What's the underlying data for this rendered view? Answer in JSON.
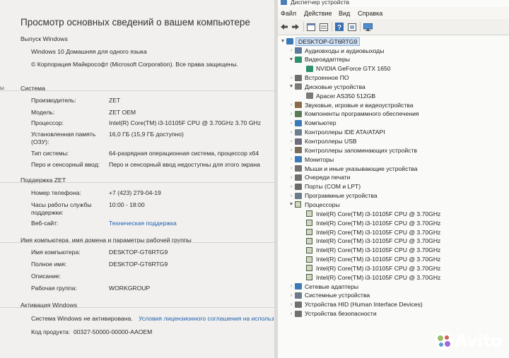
{
  "system_panel": {
    "title": "Просмотр основных сведений о вашем компьютере",
    "edition_section": "Выпуск Windows",
    "edition": "Windows 10 Домашняя для одного языка",
    "copyright": "© Корпорация Майкрософт (Microsoft Corporation). Все права защищены.",
    "edge_label_1": "",
    "edge_label_2": "ы",
    "system_section": "Система",
    "system_rows": [
      {
        "label": "Производитель:",
        "value": "ZET"
      },
      {
        "label": "Модель:",
        "value": "ZET OEM"
      },
      {
        "label": "Процессор:",
        "value": "Intel(R) Core(TM) i3-10105F CPU @ 3.70GHz   3.70 GHz"
      },
      {
        "label": "Установленная память\n(ОЗУ):",
        "value": "16,0 ГБ (15,9 ГБ доступно)"
      },
      {
        "label": "Тип системы:",
        "value": "64-разрядная операционная система, процессор x64"
      },
      {
        "label": "Перо и сенсорный ввод:",
        "value": "Перо и сенсорный ввод недоступны для этого экрана"
      }
    ],
    "support_section": "Поддержка ZET",
    "support_rows": [
      {
        "label": "Номер телефона:",
        "value": "+7 (423) 279-04-19"
      },
      {
        "label": "Часы работы службы\nподдержки:",
        "value": "10:00 - 18:00"
      },
      {
        "label": "Веб-сайт:",
        "value": "Техническая поддержка"
      }
    ],
    "name_section": "Имя компьютера, имя домена и параметры рабочей группы",
    "name_rows": [
      {
        "label": "Имя компьютера:",
        "value": "DESKTOP-GT6RTG9"
      },
      {
        "label": "Полное имя:",
        "value": "DESKTOP-GT6RTG9"
      },
      {
        "label": "Описание:",
        "value": ""
      },
      {
        "label": "Рабочая группа:",
        "value": "WORKGROUP"
      }
    ],
    "activation_section": "Активация Windows",
    "activation_status": "Система Windows не активирована.",
    "activation_link": "Условия лицензионного соглашения на использ",
    "product_code_label": "Код продукта:",
    "product_code": "00327-50000-00000-AAOEM"
  },
  "device_manager": {
    "window_title": "Диспетчер устройств",
    "menu": [
      "Файл",
      "Действие",
      "Вид",
      "Справка"
    ],
    "toolbar_icons": [
      "back-arrow-icon",
      "forward-arrow-icon",
      "properties-icon",
      "list-icon",
      "help-icon",
      "update-driver-icon",
      "monitor-scan-icon"
    ],
    "root": "DESKTOP-GT6RTG9",
    "nodes": [
      {
        "label": "Аудиовходы и аудиовыходы",
        "level": 1,
        "expanded": false,
        "icon": "audio-icon",
        "color": "#5a7a9a"
      },
      {
        "label": "Видеоадаптеры",
        "level": 1,
        "expanded": true,
        "icon": "display-adapter-icon",
        "color": "#2f8f6f"
      },
      {
        "label": "NVIDIA GeForce GTX 1650",
        "level": 2,
        "icon": "display-adapter-icon",
        "color": "#2f8f6f"
      },
      {
        "label": "Встроенное ПО",
        "level": 1,
        "expanded": false,
        "icon": "firmware-icon",
        "color": "#6d6d6d"
      },
      {
        "label": "Дисковые устройства",
        "level": 1,
        "expanded": true,
        "icon": "disk-icon",
        "color": "#7a7a7a"
      },
      {
        "label": "Apacer AS350 512GB",
        "level": 2,
        "icon": "disk-icon",
        "color": "#7a7a7a"
      },
      {
        "label": "Звуковые, игровые и видеоустройства",
        "level": 1,
        "expanded": false,
        "icon": "sound-icon",
        "color": "#8a6a4a"
      },
      {
        "label": "Компоненты программного обеспечения",
        "level": 1,
        "expanded": false,
        "icon": "software-icon",
        "color": "#5a7a5a"
      },
      {
        "label": "Компьютер",
        "level": 1,
        "expanded": false,
        "icon": "computer-icon",
        "color": "#3a7ab8"
      },
      {
        "label": "Контроллеры IDE ATA/ATAPI",
        "level": 1,
        "expanded": false,
        "icon": "ide-icon",
        "color": "#6d7d8d"
      },
      {
        "label": "Контроллеры USB",
        "level": 1,
        "expanded": false,
        "icon": "usb-icon",
        "color": "#6d6d7d"
      },
      {
        "label": "Контроллеры запоминающих устройств",
        "level": 1,
        "expanded": false,
        "icon": "storage-controller-icon",
        "color": "#7a6a5a"
      },
      {
        "label": "Мониторы",
        "level": 1,
        "expanded": false,
        "icon": "monitor-icon",
        "color": "#3a7ab8"
      },
      {
        "label": "Мыши и иные указывающие устройства",
        "level": 1,
        "expanded": false,
        "icon": "mouse-icon",
        "color": "#707070"
      },
      {
        "label": "Очереди печати",
        "level": 1,
        "expanded": false,
        "icon": "printer-icon",
        "color": "#707070"
      },
      {
        "label": "Порты (COM и LPT)",
        "level": 1,
        "expanded": false,
        "icon": "port-icon",
        "color": "#6a6a6a"
      },
      {
        "label": "Программные устройства",
        "level": 1,
        "expanded": false,
        "icon": "software-device-icon",
        "color": "#6a7a8a"
      },
      {
        "label": "Процессоры",
        "level": 1,
        "expanded": true,
        "icon": "processor-icon",
        "color": "#4b5b3e"
      },
      {
        "label": "Intel(R) Core(TM) i3-10105F CPU @ 3.70GHz",
        "level": 2,
        "icon": "processor-icon"
      },
      {
        "label": "Intel(R) Core(TM) i3-10105F CPU @ 3.70GHz",
        "level": 2,
        "icon": "processor-icon"
      },
      {
        "label": "Intel(R) Core(TM) i3-10105F CPU @ 3.70GHz",
        "level": 2,
        "icon": "processor-icon"
      },
      {
        "label": "Intel(R) Core(TM) i3-10105F CPU @ 3.70GHz",
        "level": 2,
        "icon": "processor-icon"
      },
      {
        "label": "Intel(R) Core(TM) i3-10105F CPU @ 3.70GHz",
        "level": 2,
        "icon": "processor-icon"
      },
      {
        "label": "Intel(R) Core(TM) i3-10105F CPU @ 3.70GHz",
        "level": 2,
        "icon": "processor-icon"
      },
      {
        "label": "Intel(R) Core(TM) i3-10105F CPU @ 3.70GHz",
        "level": 2,
        "icon": "processor-icon"
      },
      {
        "label": "Intel(R) Core(TM) i3-10105F CPU @ 3.70GHz",
        "level": 2,
        "icon": "processor-icon"
      },
      {
        "label": "Сетевые адаптеры",
        "level": 1,
        "expanded": false,
        "icon": "network-icon",
        "color": "#3a7ab8"
      },
      {
        "label": "Системные устройства",
        "level": 1,
        "expanded": false,
        "icon": "system-devices-icon",
        "color": "#6a7a8a"
      },
      {
        "label": "Устройства HID (Human Interface Devices)",
        "level": 1,
        "expanded": false,
        "icon": "hid-icon",
        "color": "#707070"
      },
      {
        "label": "Устройства безопасности",
        "level": 1,
        "expanded": false,
        "icon": "security-icon",
        "color": "#707070"
      }
    ]
  },
  "watermark": {
    "text": "Avito"
  }
}
